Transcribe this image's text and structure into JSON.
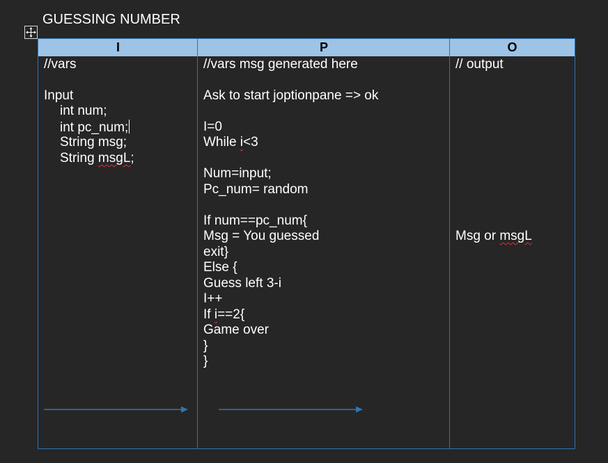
{
  "document": {
    "title": "GUESSING NUMBER"
  },
  "table": {
    "headers": [
      "I",
      "P",
      "O"
    ],
    "input_column": {
      "comment": "//vars",
      "section_label": "Input",
      "var_1": "int num;",
      "var_2": "int pc_num;",
      "var_3": "String msg;",
      "var_4_prefix": "String ",
      "var_4_word": "msgL",
      "var_4_suffix": ";"
    },
    "process_column": {
      "line_01": "//vars msg generated here",
      "line_02": "Ask to start joptionpane => ok",
      "line_03": "I=0",
      "line_04_prefix": "While ",
      "line_04_word": "i",
      "line_04_suffix": "<3",
      "line_05": "Num=input;",
      "line_06": "Pc_num= random",
      "line_07": "If num==pc_num{",
      "line_08": "Msg = You guessed",
      "line_09": "exit}",
      "line_10": "Else {",
      "line_11": "Guess left 3-i",
      "line_12": "I++",
      "line_13_prefix": "If ",
      "line_13_word": "i",
      "line_13_suffix": "==2{",
      "line_14": "Game over",
      "line_15": "}",
      "line_16": "}"
    },
    "output_column": {
      "comment": "// output",
      "result_prefix": "Msg or ",
      "result_word": "msgL"
    }
  },
  "colors": {
    "page_background": "#262626",
    "header_fill": "#9dc3e6",
    "border": "#2e74b5",
    "arrow": "#2e75b6",
    "text": "#ffffff",
    "spellcheck_squiggle": "#e03030"
  },
  "icons": {
    "table_move_handle": "move-arrows-icon",
    "flow_arrow": "right-arrow-icon"
  }
}
